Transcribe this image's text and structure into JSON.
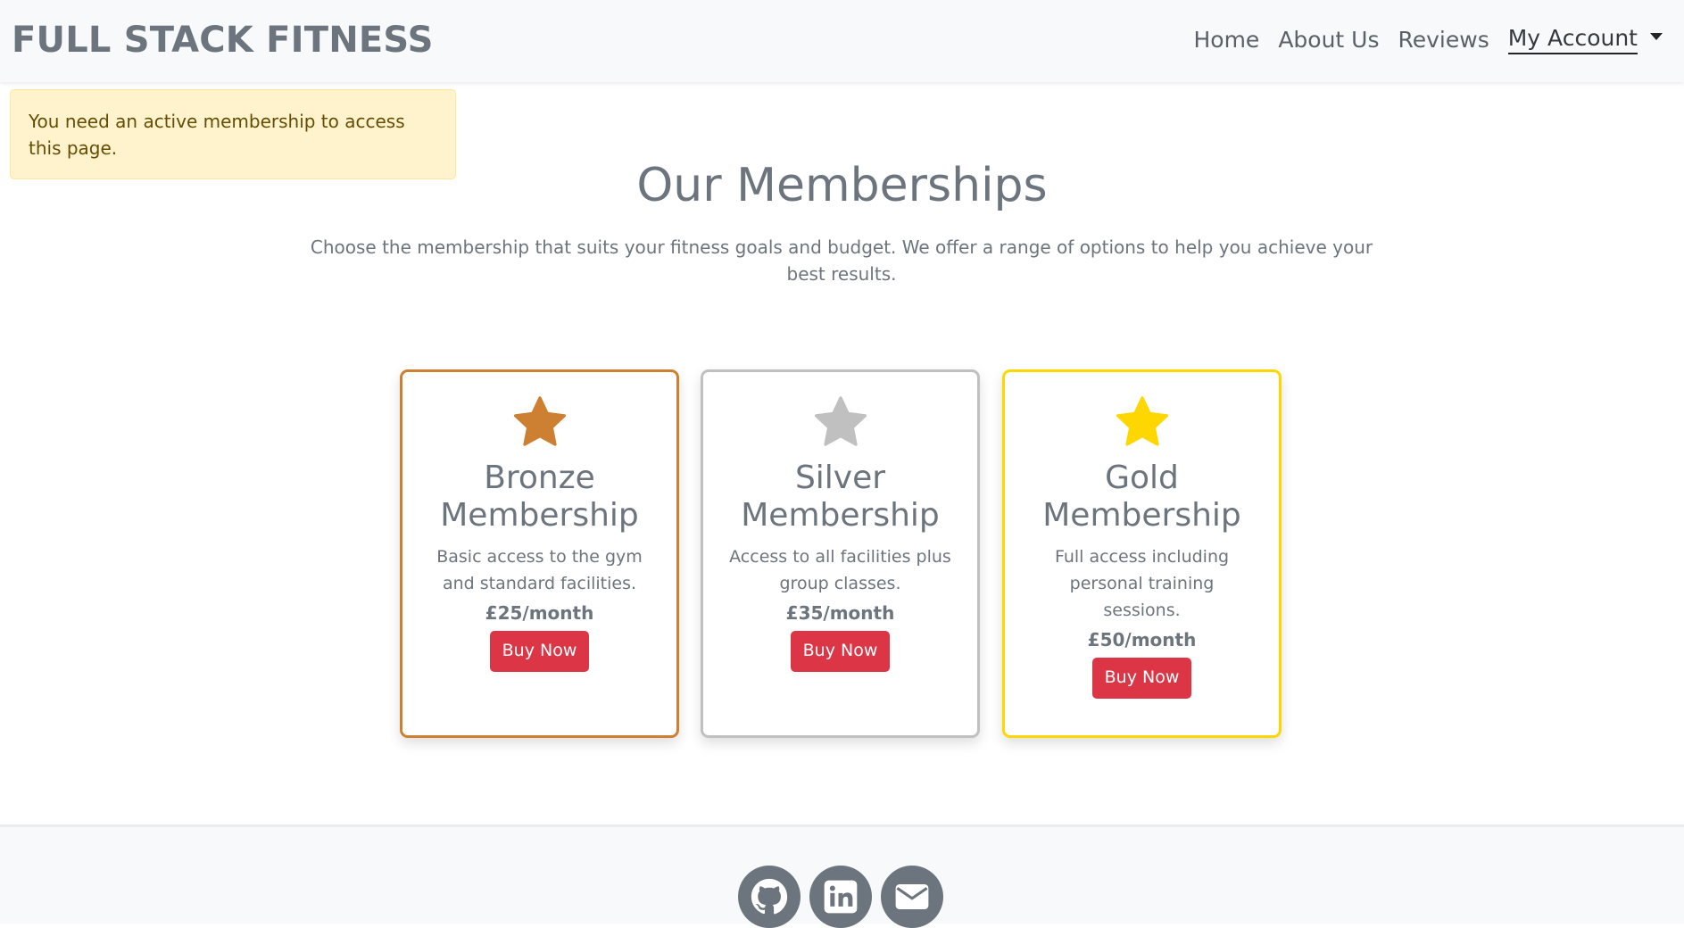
{
  "navbar": {
    "brand": "FULL STACK FITNESS",
    "links": {
      "home": "Home",
      "about": "About Us",
      "reviews": "Reviews",
      "account": "My Account"
    }
  },
  "alert": {
    "message": "You need an active membership to access this page."
  },
  "page": {
    "heading": "Our Memberships",
    "intro": "Choose the membership that suits your fitness goals and budget. We offer a range of options to help you achieve your best results."
  },
  "memberships": [
    {
      "title": "Bronze Membership",
      "description": "Basic access to the gym and standard facilities.",
      "price": "£25/month",
      "button": "Buy Now",
      "color": "#cd7f32",
      "icon": "star-icon"
    },
    {
      "title": "Silver Membership",
      "description": "Access to all facilities plus group classes.",
      "price": "£35/month",
      "button": "Buy Now",
      "color": "#c0c0c0",
      "icon": "star-icon"
    },
    {
      "title": "Gold Membership",
      "description": "Full access including personal training sessions.",
      "price": "£50/month",
      "button": "Buy Now",
      "color": "#ffd700",
      "icon": "star-icon"
    }
  ],
  "footer": {
    "social": [
      "github-icon",
      "linkedin-icon",
      "email-icon"
    ]
  },
  "colors": {
    "accent": "#dc3545",
    "text": "#6c757d",
    "alert_bg": "#fff3cd"
  }
}
